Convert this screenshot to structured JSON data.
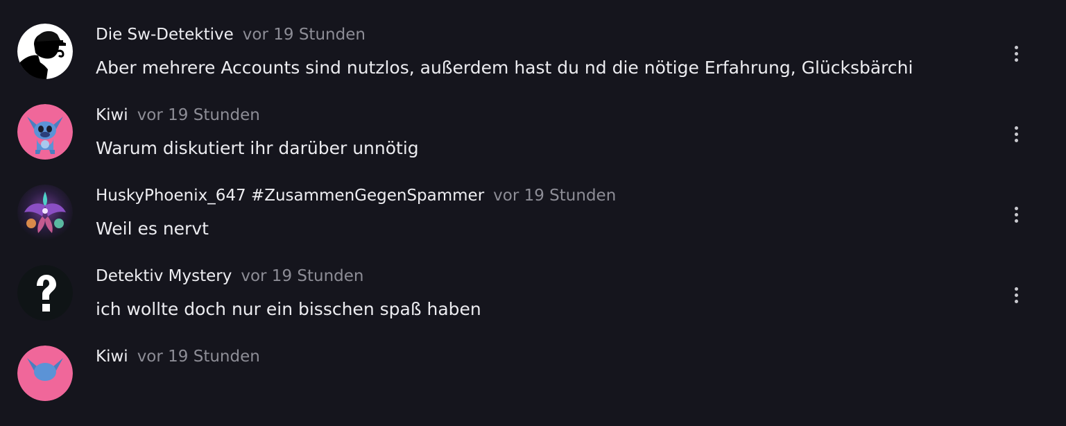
{
  "comments": [
    {
      "author": "Die Sw-Detektive",
      "time": "vor 19 Stunden",
      "text": "Aber mehrere Accounts sind nutzlos, außerdem hast du nd die nötige Erfahrung, Glücksbärchi",
      "avatar_icon": "detective-silhouette-icon"
    },
    {
      "author": "Kiwi",
      "time": "vor 19 Stunden",
      "text": "Warum diskutiert ihr darüber unnötig",
      "avatar_icon": "stitch-character-icon"
    },
    {
      "author": "HuskyPhoenix_647 #ZusammenGegenSpammer",
      "time": "vor 19 Stunden",
      "text": "Weil es nervt",
      "avatar_icon": "phoenix-icon"
    },
    {
      "author": "Detektiv Mystery",
      "time": "vor 19 Stunden",
      "text": "ich wollte doch nur ein bisschen spaß haben",
      "avatar_icon": "question-mark-icon"
    },
    {
      "author": "Kiwi",
      "time": "vor 19 Stunden",
      "text": "",
      "avatar_icon": "stitch-character-icon"
    }
  ],
  "more_options_icon": "vertical-ellipsis-icon",
  "colors": {
    "background": "#15151d",
    "author_text": "#eeeef2",
    "timestamp_text": "#8d8d96",
    "body_text": "#ececf0",
    "pink_avatar": "#f0679a"
  }
}
